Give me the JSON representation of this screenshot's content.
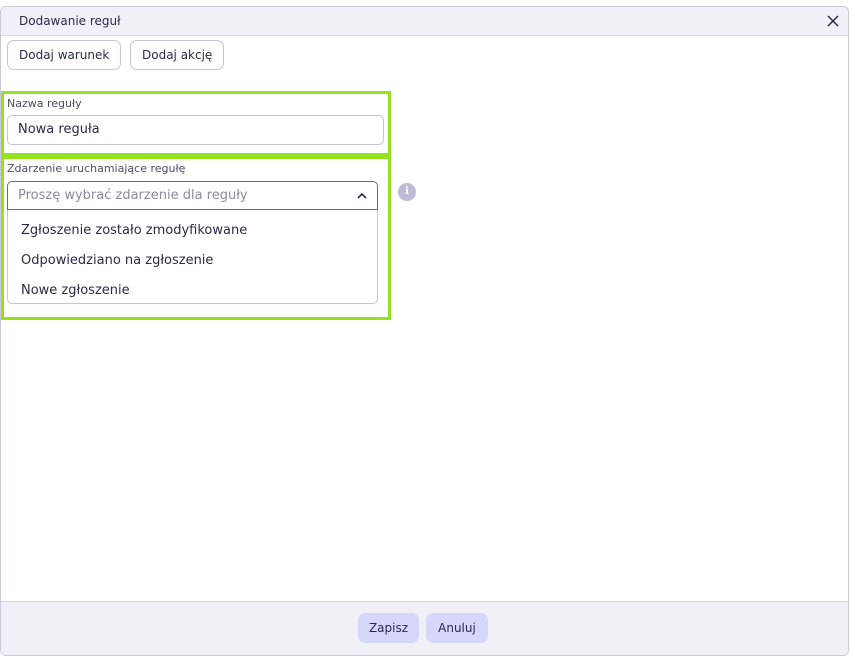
{
  "dialog": {
    "title": "Dodawanie reguł",
    "close_icon": "close-icon"
  },
  "toolbar": {
    "add_condition_label": "Dodaj warunek",
    "add_action_label": "Dodaj akcję"
  },
  "rule_name": {
    "label": "Nazwa reguły",
    "value": "Nowa reguła"
  },
  "trigger_event": {
    "label": "Zdarzenie uruchamiające regułę",
    "placeholder": "Proszę wybrać zdarzenie dla reguły",
    "chevron_icon": "chevron-up-icon",
    "info_icon": "info-icon",
    "options": [
      "Zgłoszenie zostało zmodyfikowane",
      "Odpowiedziano na zgłoszenie",
      "Nowe zgłoszenie"
    ]
  },
  "footer": {
    "save_label": "Zapisz",
    "cancel_label": "Anuluj"
  },
  "colors": {
    "highlight": "#94e11e",
    "primary_button": "#d6d7fb",
    "header_bg": "#f0f0f6"
  }
}
